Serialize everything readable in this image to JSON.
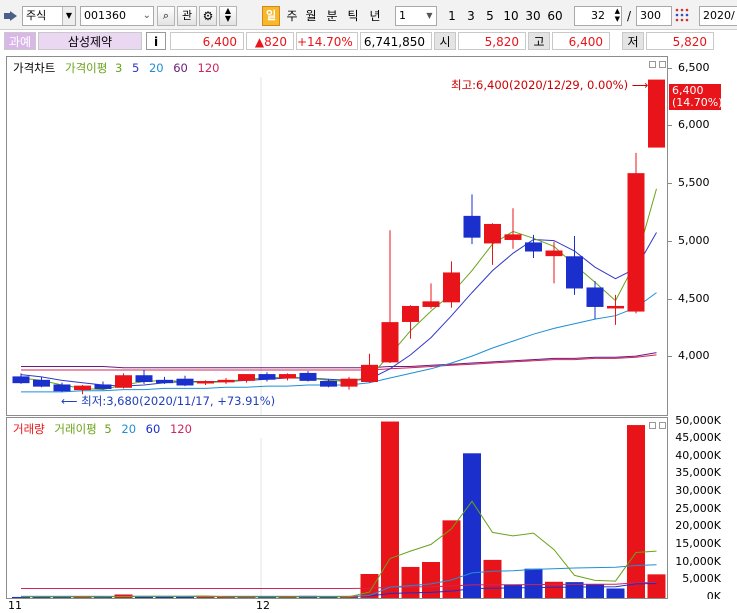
{
  "toolbar": {
    "market_select": "주식",
    "code_input": "001360",
    "btn_gwan": "관",
    "btn_il": "일",
    "btn_ju": "주",
    "btn_wol": "월",
    "btn_bun": "분",
    "btn_tik": "틱",
    "btn_nyeon": "년",
    "period_select": "1",
    "period_opts": [
      "1",
      "3",
      "5",
      "10",
      "30",
      "60"
    ],
    "count_input": "32",
    "slash": "/",
    "total_input": "300",
    "date_input": "2020/"
  },
  "infobar": {
    "tag": "과예",
    "stock_name": "삼성제약",
    "info_btn": "i",
    "price": "6,400",
    "change": "▲820",
    "change_pct": "+14.70%",
    "volume": "6,741,850",
    "open_label": "시",
    "open": "5,820",
    "high_label": "고",
    "high": "6,400",
    "low_label": "저",
    "low": "5,820"
  },
  "price_legend": {
    "chart_name": "가격차트",
    "ma_name": "가격이평",
    "periods": [
      "3",
      "5",
      "20",
      "60",
      "120"
    ]
  },
  "volume_legend": {
    "chart_name": "거래량",
    "ma_name": "거래이평",
    "periods": [
      "5",
      "20",
      "60",
      "120"
    ]
  },
  "annotations": {
    "high_note": "최고:6,400(2020/12/29, 0.00%)",
    "low_note": "최저:3,680(2020/11/17, +73.91%)",
    "last_price": "6,400",
    "last_pct": "(14.70%)"
  },
  "x_labels": [
    "11",
    "12"
  ],
  "colors": {
    "up": "#e8141a",
    "down": "#1a2fcc",
    "ma3": "#6aa31a",
    "ma5": "#3138c7",
    "ma20": "#1f8fd6",
    "ma60": "#6b1a7d",
    "ma120": "#d0245a",
    "annotation_red": "#cc0000",
    "annotation_blue": "#1f3fbf"
  },
  "chart_data": [
    {
      "type": "candlestick",
      "title": "가격차트",
      "ylim": [
        3500,
        6600
      ],
      "yticks": [
        4000,
        4500,
        5000,
        5500,
        6000,
        6500
      ],
      "ytick_labels": [
        "4,000",
        "4,500",
        "5,000",
        "5,500",
        "6,000",
        "6,500"
      ],
      "x_axis_labels": [
        "11",
        "12"
      ],
      "candles": [
        {
          "o": 3830,
          "h": 3860,
          "l": 3770,
          "c": 3780
        },
        {
          "o": 3800,
          "h": 3830,
          "l": 3740,
          "c": 3750
        },
        {
          "o": 3760,
          "h": 3780,
          "l": 3700,
          "c": 3710
        },
        {
          "o": 3720,
          "h": 3760,
          "l": 3680,
          "c": 3750
        },
        {
          "o": 3760,
          "h": 3790,
          "l": 3720,
          "c": 3730
        },
        {
          "o": 3740,
          "h": 3860,
          "l": 3730,
          "c": 3840
        },
        {
          "o": 3840,
          "h": 3890,
          "l": 3770,
          "c": 3790
        },
        {
          "o": 3800,
          "h": 3830,
          "l": 3770,
          "c": 3780
        },
        {
          "o": 3810,
          "h": 3840,
          "l": 3750,
          "c": 3760
        },
        {
          "o": 3780,
          "h": 3800,
          "l": 3760,
          "c": 3790
        },
        {
          "o": 3790,
          "h": 3820,
          "l": 3770,
          "c": 3800
        },
        {
          "o": 3800,
          "h": 3850,
          "l": 3780,
          "c": 3850
        },
        {
          "o": 3850,
          "h": 3870,
          "l": 3790,
          "c": 3810
        },
        {
          "o": 3820,
          "h": 3860,
          "l": 3800,
          "c": 3850
        },
        {
          "o": 3860,
          "h": 3880,
          "l": 3790,
          "c": 3800
        },
        {
          "o": 3790,
          "h": 3810,
          "l": 3740,
          "c": 3750
        },
        {
          "o": 3750,
          "h": 3830,
          "l": 3720,
          "c": 3810
        },
        {
          "o": 3790,
          "h": 4030,
          "l": 3780,
          "c": 3930
        },
        {
          "o": 3960,
          "h": 5100,
          "l": 3950,
          "c": 4300
        },
        {
          "o": 4310,
          "h": 4450,
          "l": 4160,
          "c": 4440
        },
        {
          "o": 4440,
          "h": 4640,
          "l": 4420,
          "c": 4480
        },
        {
          "o": 4480,
          "h": 4830,
          "l": 4430,
          "c": 4730
        },
        {
          "o": 5220,
          "h": 5410,
          "l": 4980,
          "c": 5040
        },
        {
          "o": 4990,
          "h": 5160,
          "l": 4800,
          "c": 5150
        },
        {
          "o": 5020,
          "h": 5290,
          "l": 4940,
          "c": 5060
        },
        {
          "o": 4990,
          "h": 5060,
          "l": 4860,
          "c": 4920
        },
        {
          "o": 4880,
          "h": 5000,
          "l": 4640,
          "c": 4920
        },
        {
          "o": 4870,
          "h": 5050,
          "l": 4540,
          "c": 4600
        },
        {
          "o": 4600,
          "h": 4660,
          "l": 4330,
          "c": 4440
        },
        {
          "o": 4440,
          "h": 4540,
          "l": 4280,
          "c": 4440
        },
        {
          "o": 4400,
          "h": 5770,
          "l": 4380,
          "c": 5590
        },
        {
          "o": 5820,
          "h": 6400,
          "l": 5820,
          "c": 6400
        }
      ],
      "ma3": [
        3820,
        3800,
        3760,
        3730,
        3720,
        3760,
        3790,
        3800,
        3790,
        3780,
        3790,
        3810,
        3820,
        3830,
        3820,
        3800,
        3790,
        3830,
        4020,
        4230,
        4400,
        4550,
        4750,
        4980,
        5090,
        5030,
        4960,
        4800,
        4650,
        4490,
        4830,
        5460
      ],
      "ma5": [
        3850,
        3830,
        3800,
        3780,
        3760,
        3750,
        3760,
        3780,
        3790,
        3790,
        3790,
        3800,
        3810,
        3820,
        3820,
        3810,
        3800,
        3810,
        3900,
        4020,
        4170,
        4360,
        4560,
        4750,
        4900,
        5020,
        5010,
        4920,
        4780,
        4680,
        4770,
        5080
      ],
      "ma20": [
        3700,
        3700,
        3700,
        3710,
        3710,
        3720,
        3720,
        3730,
        3730,
        3730,
        3740,
        3740,
        3750,
        3750,
        3760,
        3760,
        3760,
        3780,
        3820,
        3860,
        3900,
        3950,
        4010,
        4080,
        4140,
        4200,
        4250,
        4290,
        4330,
        4360,
        4430,
        4560
      ],
      "ma60": [
        3920,
        3920,
        3920,
        3920,
        3920,
        3910,
        3910,
        3910,
        3910,
        3910,
        3910,
        3910,
        3910,
        3910,
        3910,
        3910,
        3910,
        3910,
        3920,
        3920,
        3930,
        3940,
        3950,
        3960,
        3970,
        3980,
        3990,
        3990,
        4000,
        4000,
        4010,
        4040
      ],
      "ma120": [
        3890,
        3890,
        3890,
        3890,
        3890,
        3890,
        3890,
        3890,
        3890,
        3890,
        3890,
        3890,
        3890,
        3890,
        3890,
        3890,
        3890,
        3890,
        3900,
        3910,
        3920,
        3930,
        3940,
        3950,
        3960,
        3970,
        3980,
        3980,
        3990,
        3990,
        4000,
        4020
      ]
    },
    {
      "type": "bar",
      "title": "거래량",
      "ylim": [
        0,
        51000
      ],
      "yticks": [
        0,
        5000,
        10000,
        15000,
        20000,
        25000,
        30000,
        35000,
        40000,
        45000,
        50000
      ],
      "ytick_labels": [
        "0K",
        "5,000K",
        "10,000K",
        "15,000K",
        "20,000K",
        "25,000K",
        "30,000K",
        "35,000K",
        "40,000K",
        "45,000K",
        "50,000K"
      ],
      "values": [
        300,
        400,
        300,
        300,
        300,
        1000,
        500,
        300,
        400,
        300,
        300,
        300,
        300,
        300,
        600,
        300,
        400,
        6800,
        50000,
        8800,
        10200,
        22000,
        41000,
        10800,
        3800,
        8300,
        4600,
        4500,
        3900,
        2700,
        49000,
        6700
      ],
      "up": [
        false,
        false,
        false,
        true,
        false,
        true,
        false,
        false,
        false,
        true,
        true,
        true,
        false,
        true,
        false,
        false,
        true,
        true,
        true,
        true,
        true,
        true,
        false,
        true,
        false,
        false,
        true,
        false,
        false,
        false,
        true,
        true
      ],
      "ma5": [
        400,
        400,
        350,
        350,
        320,
        460,
        480,
        480,
        500,
        560,
        360,
        320,
        320,
        300,
        360,
        360,
        380,
        1680,
        11200,
        13300,
        15200,
        19600,
        27400,
        18600,
        17600,
        18400,
        13700,
        6400,
        5000,
        4800,
        12900,
        13300
      ],
      "ma20": [
        400,
        400,
        400,
        400,
        400,
        420,
        420,
        420,
        420,
        420,
        410,
        410,
        400,
        400,
        400,
        400,
        400,
        700,
        3100,
        3500,
        4000,
        5100,
        7100,
        7600,
        7700,
        8100,
        8300,
        8500,
        8600,
        8700,
        9200,
        9400
      ],
      "ma60": [
        450,
        450,
        450,
        450,
        450,
        450,
        450,
        450,
        450,
        450,
        450,
        450,
        450,
        450,
        450,
        450,
        450,
        550,
        1300,
        1450,
        1600,
        1950,
        2650,
        2800,
        2850,
        2950,
        3050,
        3100,
        3150,
        3200,
        4000,
        4100
      ],
      "ma120": [
        2700,
        2700,
        2700,
        2700,
        2700,
        2700,
        2700,
        2700,
        2700,
        2700,
        2700,
        2700,
        2700,
        2700,
        2700,
        2700,
        2700,
        2750,
        3100,
        3150,
        3200,
        3400,
        3700,
        3750,
        3750,
        3800,
        3850,
        3850,
        3900,
        3900,
        4300,
        4350
      ]
    }
  ]
}
